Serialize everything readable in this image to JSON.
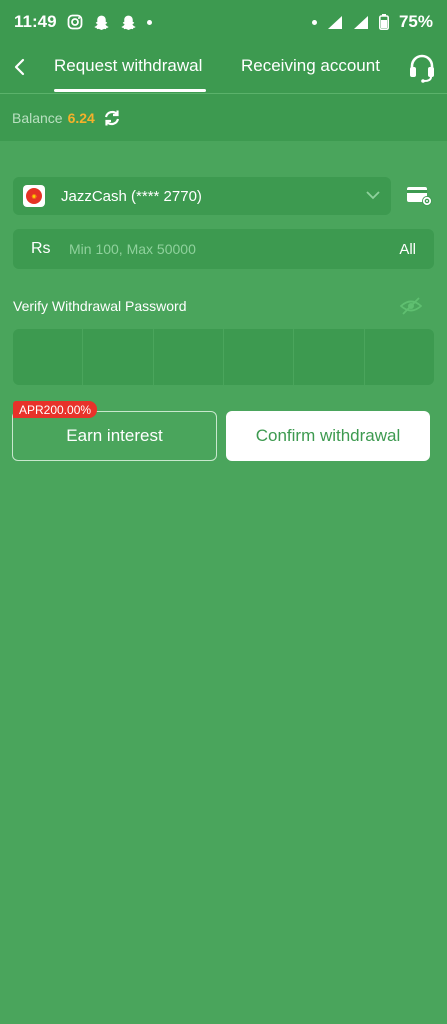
{
  "status_bar": {
    "time": "11:49",
    "battery": "75%"
  },
  "header": {
    "tabs": [
      {
        "label": "Request withdrawal",
        "active": true
      },
      {
        "label": "Receiving account",
        "active": false
      }
    ]
  },
  "balance": {
    "label": "Balance",
    "value": "6.24"
  },
  "account": {
    "provider": "JazzCash",
    "name": "JazzCash (**** 2770)"
  },
  "amount": {
    "currency": "Rs",
    "placeholder": "Min 100, Max 50000",
    "all_label": "All"
  },
  "password": {
    "label": "Verify Withdrawal Password",
    "cells": 6
  },
  "actions": {
    "apr_badge": "APR200.00%",
    "earn_label": "Earn interest",
    "confirm_label": "Confirm withdrawal"
  },
  "colors": {
    "background": "#4aa55c",
    "panel": "#3d9a50",
    "balance_value": "#f5b12a",
    "badge": "#e8322a"
  }
}
